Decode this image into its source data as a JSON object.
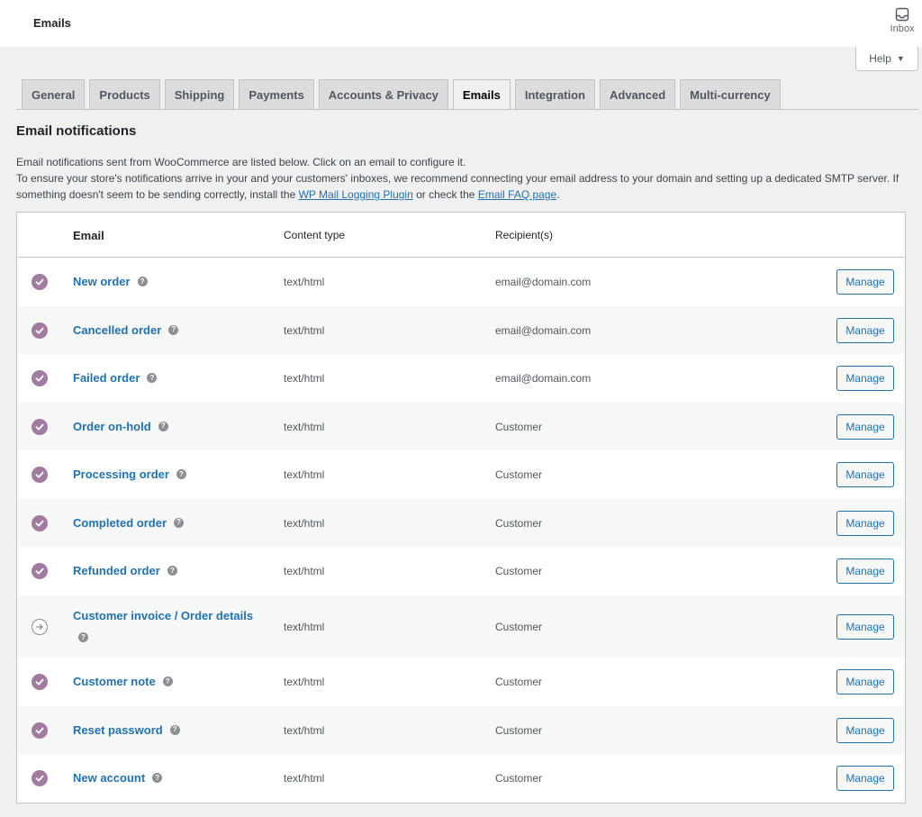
{
  "header": {
    "title": "Emails",
    "inbox_label": "Inbox"
  },
  "help": {
    "label": "Help"
  },
  "tabs": [
    {
      "label": "General",
      "active": false
    },
    {
      "label": "Products",
      "active": false
    },
    {
      "label": "Shipping",
      "active": false
    },
    {
      "label": "Payments",
      "active": false
    },
    {
      "label": "Accounts & Privacy",
      "active": false
    },
    {
      "label": "Emails",
      "active": true
    },
    {
      "label": "Integration",
      "active": false
    },
    {
      "label": "Advanced",
      "active": false
    },
    {
      "label": "Multi-currency",
      "active": false
    }
  ],
  "section": {
    "title": "Email notifications",
    "intro_line1": "Email notifications sent from WooCommerce are listed below. Click on an email to configure it.",
    "intro_line2": "To ensure your store's notifications arrive in your and your customers' inboxes, we recommend connecting your email address to your domain and setting up a dedicated SMTP server. If something doesn't seem to be sending correctly, install the ",
    "link1": "WP Mail Logging Plugin",
    "intro_mid": " or check the ",
    "link2": "Email FAQ page",
    "intro_end": "."
  },
  "table": {
    "headers": {
      "email": "Email",
      "content_type": "Content type",
      "recipients": "Recipient(s)"
    },
    "manage_label": "Manage",
    "rows": [
      {
        "name": "New order",
        "content_type": "text/html",
        "recipient": "email@domain.com",
        "status": "enabled"
      },
      {
        "name": "Cancelled order",
        "content_type": "text/html",
        "recipient": "email@domain.com",
        "status": "enabled"
      },
      {
        "name": "Failed order",
        "content_type": "text/html",
        "recipient": "email@domain.com",
        "status": "enabled"
      },
      {
        "name": "Order on-hold",
        "content_type": "text/html",
        "recipient": "Customer",
        "status": "enabled"
      },
      {
        "name": "Processing order",
        "content_type": "text/html",
        "recipient": "Customer",
        "status": "enabled"
      },
      {
        "name": "Completed order",
        "content_type": "text/html",
        "recipient": "Customer",
        "status": "enabled"
      },
      {
        "name": "Refunded order",
        "content_type": "text/html",
        "recipient": "Customer",
        "status": "enabled"
      },
      {
        "name": "Customer invoice / Order details",
        "content_type": "text/html",
        "recipient": "Customer",
        "status": "manual"
      },
      {
        "name": "Customer note",
        "content_type": "text/html",
        "recipient": "Customer",
        "status": "enabled"
      },
      {
        "name": "Reset password",
        "content_type": "text/html",
        "recipient": "Customer",
        "status": "enabled"
      },
      {
        "name": "New account",
        "content_type": "text/html",
        "recipient": "Customer",
        "status": "enabled"
      }
    ]
  },
  "colors": {
    "accent": "#2271b1",
    "enabled": "#a27ba0",
    "background": "#f0f0f1"
  },
  "icons": {
    "enabled": "check-circle-icon",
    "manual": "arrow-circle-icon",
    "help": "question-icon",
    "inbox": "inbox-icon"
  }
}
